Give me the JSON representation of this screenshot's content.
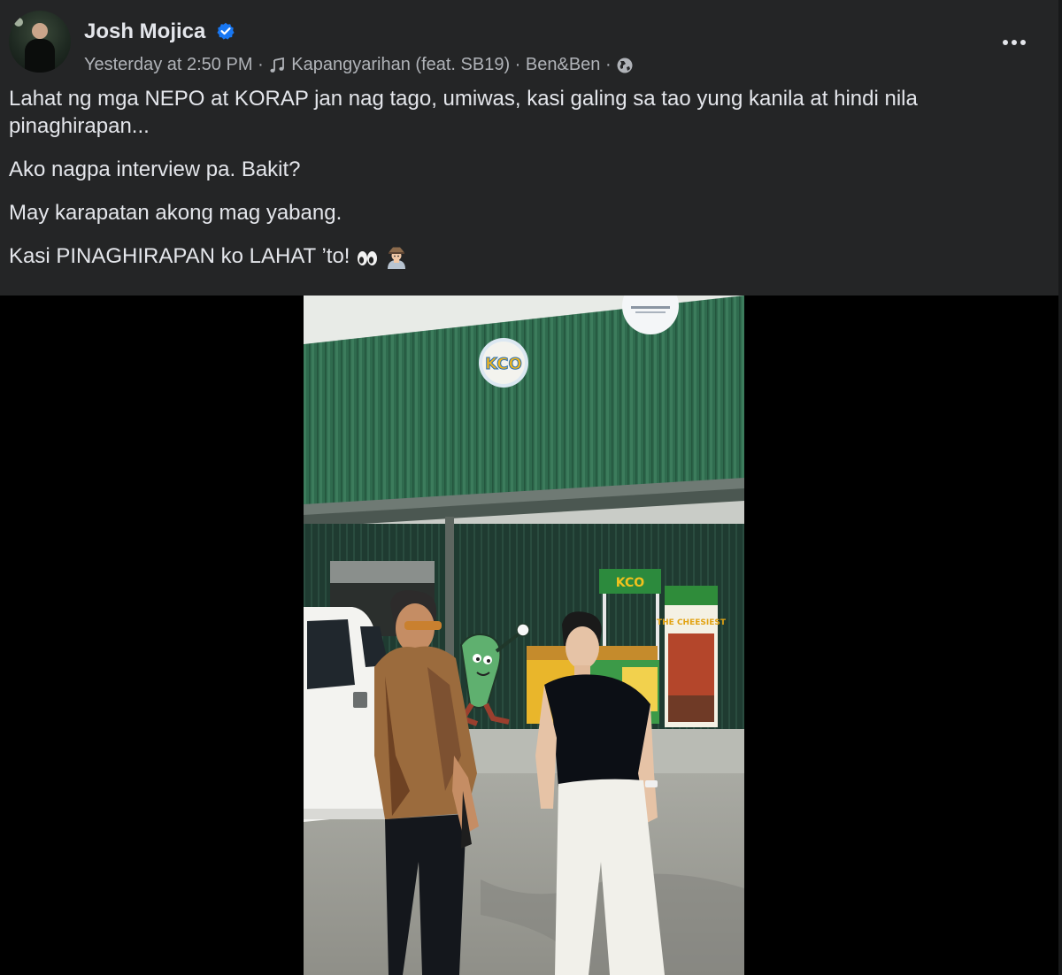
{
  "post": {
    "author": "Josh Mojica",
    "verified": true,
    "timestamp": "Yesterday at 2:50 PM",
    "separator": "·",
    "song": "Kapangyarihan (feat. SB19) · Ben&Ben",
    "audience_icon": "globe-icon",
    "more_icon": "more-options-icon",
    "paragraphs": [
      "Lahat ng mga NEPO at KORAP jan nag tago, umiwas, kasi galing sa tao yung kanila at hindi nila pinaghirapan...",
      "Ako nagpa interview pa. Bakit?",
      "May karapatan akong mag yabang.",
      "Kasi PINAGHIRAPAN ko LAHAT ’to!"
    ],
    "emojis": [
      "eyes-emoji",
      "detective-emoji"
    ]
  },
  "photo": {
    "signs": {
      "kco_logo": "KCO",
      "booth_logo": "KCO",
      "banner_title": "THE CHEESIEST"
    }
  },
  "colors": {
    "background": "#242526",
    "text_primary": "#e4e6eb",
    "text_secondary": "#b0b3b8",
    "verified_blue": "#1877f2",
    "warehouse_green": "#2f6b4e"
  }
}
